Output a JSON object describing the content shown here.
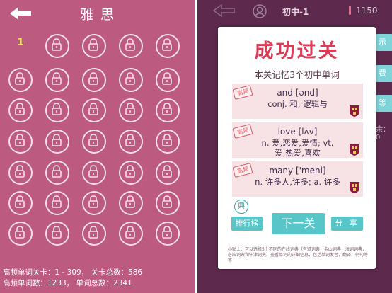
{
  "left_screen": {
    "title": "雅 思",
    "current_level": "1",
    "stats_line1": "高频单词关卡：1 - 309， 关卡总数：586",
    "stats_line2": "高频单词数：1233， 单词总数：2341",
    "colors": {
      "background": "#bd5a7f",
      "ring": "#f4dfe7",
      "current_level": "#f6e064"
    }
  },
  "right_screen": {
    "grade": "初中-1",
    "coins": "1150",
    "side_buttons": [
      "示",
      "费",
      "等"
    ],
    "side_text": "余：0",
    "dialog": {
      "headline": "成功过关",
      "subtitle": "本关记忆3个初中单词",
      "words": [
        {
          "badge": "高频",
          "word": "and [ənd]",
          "meaning": [
            "conj. 和; 逻辑与"
          ]
        },
        {
          "badge": "高频",
          "word": "love [lʌv]",
          "meaning": [
            "n. 爱,恋爱,爱情; vt.",
            "爱,热爱,喜欢"
          ]
        },
        {
          "badge": "高频",
          "word": "many ['meni]",
          "meaning": [
            "n. 许多人,许多; a. 许多"
          ]
        }
      ],
      "dict_icon_label": "典",
      "rank_button": "排行榜",
      "next_button": "下一关",
      "share_button": "分 享",
      "tip": "小贴士：可以选择5个不同的在线词典（有道词典，金山词典，海词词典，必应词典和牛津词典）查看单词的详细信息，包括单词发音，翻译，例句等等"
    },
    "colors": {
      "background": "#5d2a4e",
      "accent": "#58c5c8",
      "headline": "#dc3b56"
    }
  }
}
